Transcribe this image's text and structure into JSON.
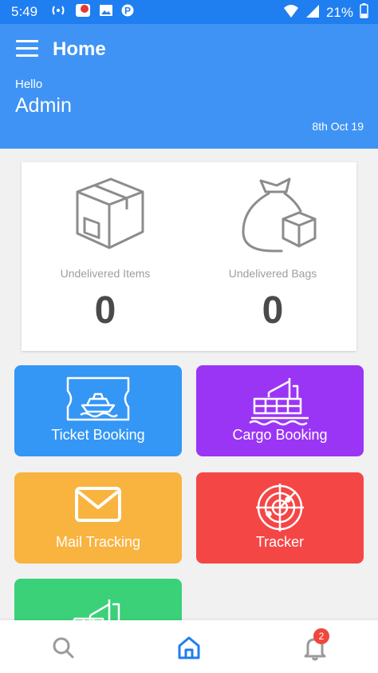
{
  "status_bar": {
    "time": "5:49",
    "battery": "21%"
  },
  "app_bar": {
    "title": "Home",
    "greeting": "Hello",
    "user": "Admin",
    "date": "8th Oct 19"
  },
  "stats": [
    {
      "label": "Undelivered Items",
      "value": "0",
      "icon": "box-icon"
    },
    {
      "label": "Undelivered Bags",
      "value": "0",
      "icon": "money-bag-icon"
    }
  ],
  "tiles": [
    {
      "label": "Ticket Booking",
      "color": "#3496f5",
      "icon": "ship-ticket-icon"
    },
    {
      "label": "Cargo Booking",
      "color": "#9b35f5",
      "icon": "cargo-ship-icon"
    },
    {
      "label": "Mail Tracking",
      "color": "#f9b33f",
      "icon": "mail-icon"
    },
    {
      "label": "Tracker",
      "color": "#f54646",
      "icon": "radar-icon"
    },
    {
      "label": "",
      "color": "#3ad179",
      "icon": "crane-ship-icon"
    }
  ],
  "bottom_nav": {
    "items": [
      "search-icon",
      "home-icon",
      "bell-icon"
    ],
    "notification_count": "2",
    "active_color": "#1f7ef0"
  }
}
